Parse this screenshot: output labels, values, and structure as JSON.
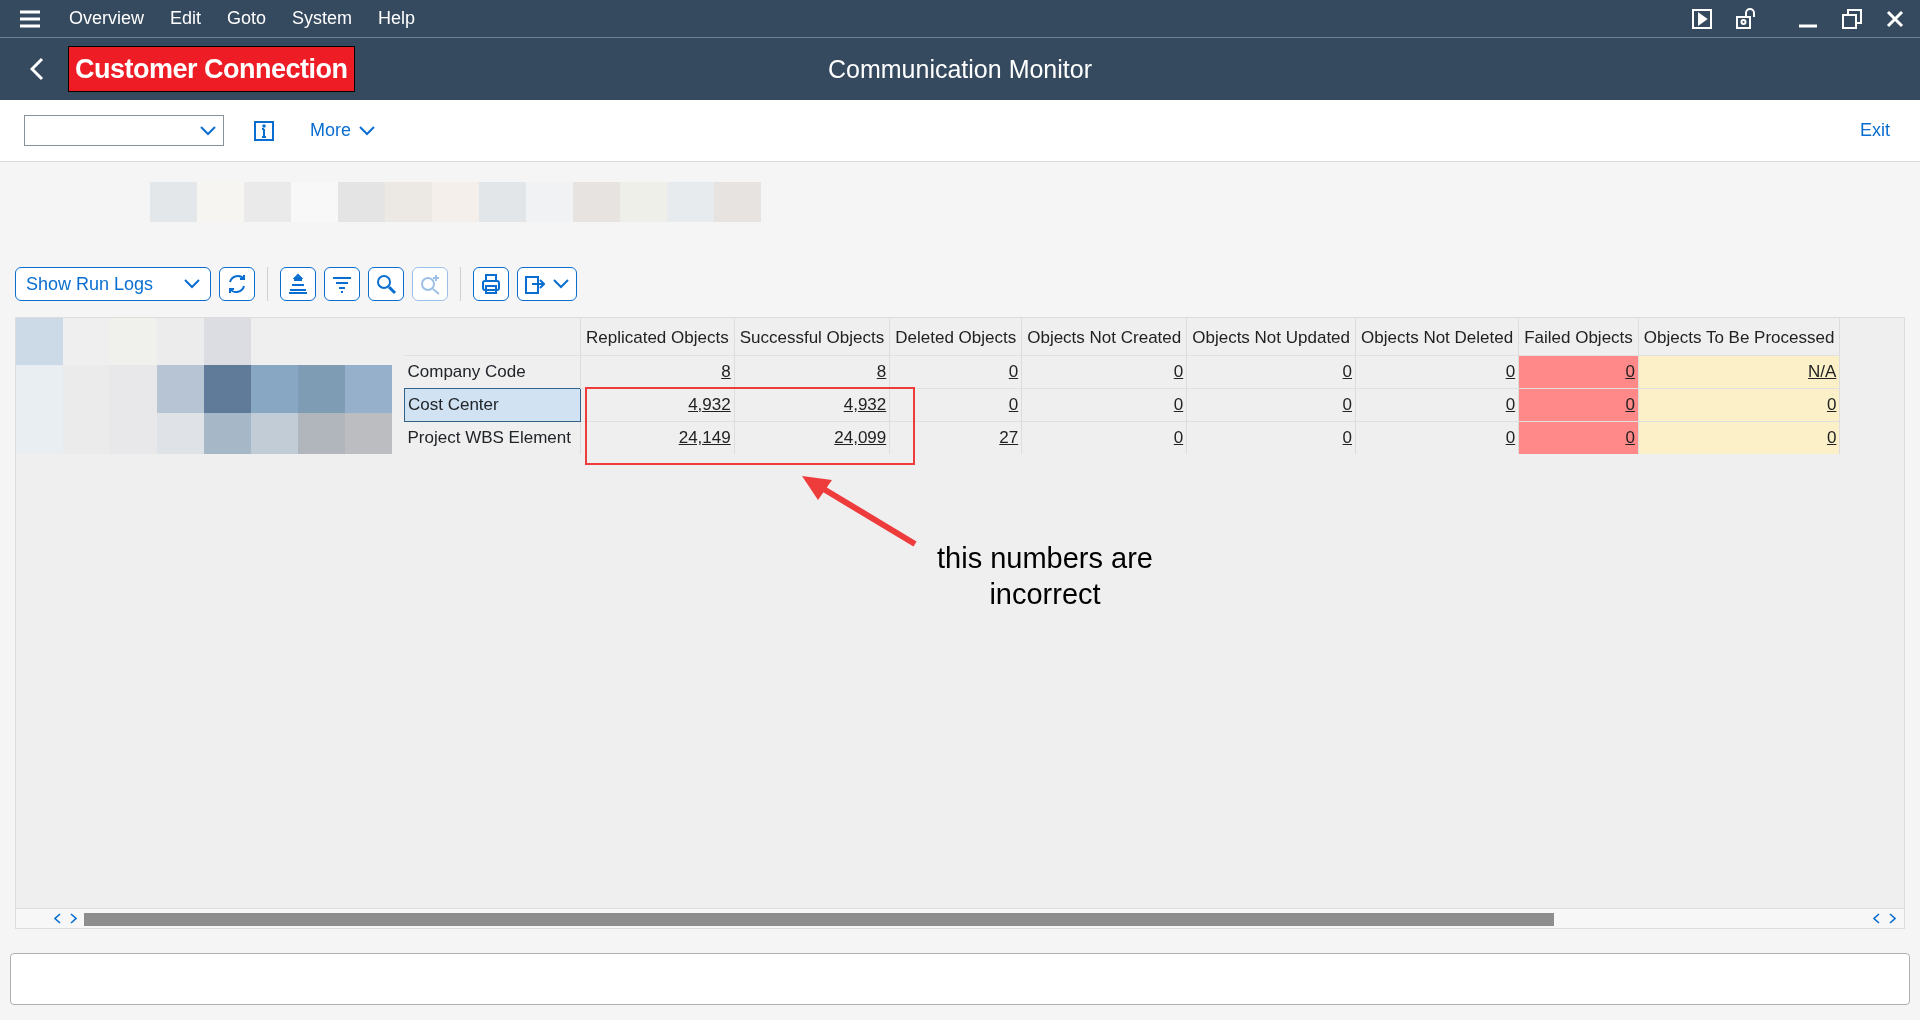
{
  "menu_bar": {
    "items": [
      "Overview",
      "Edit",
      "Goto",
      "System",
      "Help"
    ]
  },
  "title_bar": {
    "logo_text": "Customer Connection",
    "title": "Communication Monitor"
  },
  "app_toolbar": {
    "more_label": "More",
    "exit_label": "Exit"
  },
  "alv_toolbar": {
    "run_logs_button": "Show Run Logs"
  },
  "table": {
    "columns": [
      {
        "label": "Replicated Objects"
      },
      {
        "label": "Successful Objects"
      },
      {
        "label": "Deleted Objects"
      },
      {
        "label": "Objects Not Created"
      },
      {
        "label": "Objects Not Updated"
      },
      {
        "label": "Objects Not Deleted"
      },
      {
        "label": "Failed Objects",
        "color": "#ff8888"
      },
      {
        "label": "Objects To Be Processed",
        "color": "#fbf0c8"
      }
    ],
    "rows": [
      {
        "label": "Company Code",
        "selected": false,
        "cells": [
          "8",
          "8",
          "0",
          "0",
          "0",
          "0",
          "0",
          "N/A"
        ]
      },
      {
        "label": "Cost Center",
        "selected": true,
        "cells": [
          "4,932",
          "4,932",
          "0",
          "0",
          "0",
          "0",
          "0",
          "0"
        ]
      },
      {
        "label": "Project WBS Element",
        "selected": false,
        "cells": [
          "24,149",
          "24,099",
          "27",
          "0",
          "0",
          "0",
          "0",
          "0"
        ]
      }
    ]
  },
  "annotation": {
    "text": "this numbers are incorrect"
  }
}
